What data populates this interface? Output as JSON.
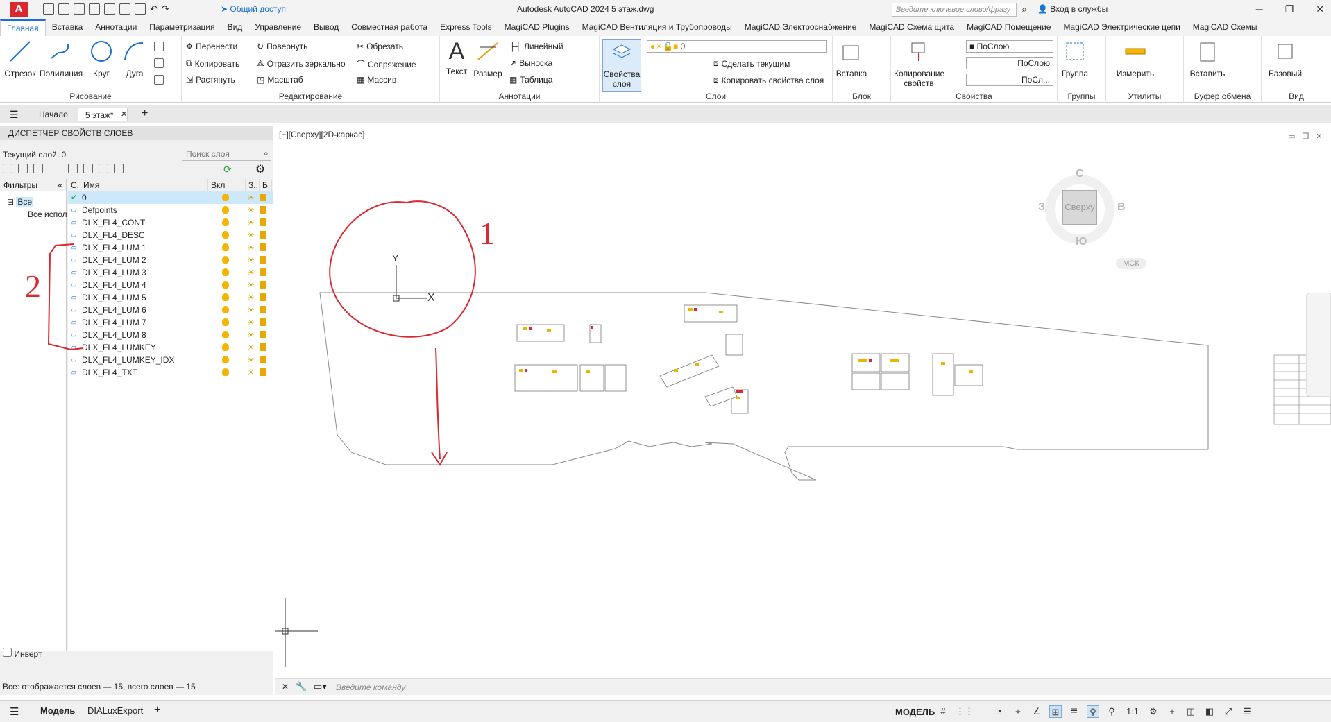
{
  "app": {
    "logo": "A",
    "share": "Общий доступ",
    "title": "Autodesk AutoCAD 2024    5 этаж.dwg",
    "search_placeholder": "Введите ключевое слово/фразу",
    "signin": "Вход в службы"
  },
  "ribbon_tabs": [
    "Главная",
    "Вставка",
    "Аннотации",
    "Параметризация",
    "Вид",
    "Управление",
    "Вывод",
    "Совместная работа",
    "Express Tools",
    "MagiCAD Plugins",
    "MagiCAD Вентиляция и Трубопроводы",
    "MagiCAD Электроснабжение",
    "MagiCAD Схема щита",
    "MagiCAD Помещение",
    "MagiCAD Электрические цепи",
    "MagiCAD Схемы"
  ],
  "ribbon": {
    "draw": {
      "title": "Рисование",
      "line": "Отрезок",
      "polyline": "Полилиния",
      "circle": "Круг",
      "arc": "Дуга"
    },
    "modify": {
      "title": "Редактирование",
      "move": "Перенести",
      "rotate": "Повернуть",
      "trim": "Обрезать",
      "copy": "Копировать",
      "mirror": "Отразить зеркально",
      "fillet": "Сопряжение",
      "stretch": "Растянуть",
      "scale": "Масштаб",
      "array": "Массив"
    },
    "annot": {
      "title": "Аннотации",
      "text": "Текст",
      "dim": "Размер",
      "linear": "Линейный",
      "leader": "Выноска",
      "table": "Таблица"
    },
    "layers": {
      "title": "Слои",
      "props": "Свойства слоя",
      "current_layer": "0",
      "make_current": "Сделать текущим",
      "match": "Копировать свойства слоя"
    },
    "block": {
      "title": "Блок",
      "insert": "Вставка"
    },
    "props": {
      "title": "Свойства",
      "match": "Копирование свойств",
      "color": "ПоСлою",
      "linetype": "ПоСлою",
      "lineweight": "ПоСл..."
    },
    "groups": {
      "title": "Группы",
      "group": "Группа"
    },
    "utils": {
      "title": "Утилиты",
      "measure": "Измерить"
    },
    "clip": {
      "title": "Буфер обмена",
      "paste": "Вставить"
    },
    "view": {
      "title": "Вид",
      "base": "Базовый"
    }
  },
  "doc_tabs": [
    "Начало",
    "5 этаж*"
  ],
  "palette": {
    "title": "ДИСПЕТЧЕР СВОЙСТВ СЛОЕВ",
    "current": "Текущий слой: 0",
    "search": "Поиск слоя",
    "filters": "Фильтры",
    "tree_all": "Все",
    "tree_used": "Все используемые слои",
    "headers": {
      "status": "С.",
      "name": "Имя",
      "on": "Вкл",
      "freeze": "З..",
      "lock": "Б."
    },
    "layers": [
      "0",
      "Defpoints",
      "DLX_FL4_CONT",
      "DLX_FL4_DESC",
      "DLX_FL4_LUM 1",
      "DLX_FL4_LUM 2",
      "DLX_FL4_LUM 3",
      "DLX_FL4_LUM 4",
      "DLX_FL4_LUM 5",
      "DLX_FL4_LUM 6",
      "DLX_FL4_LUM 7",
      "DLX_FL4_LUM 8",
      "DLX_FL4_LUMKEY",
      "DLX_FL4_LUMKEY_IDX",
      "DLX_FL4_TXT"
    ],
    "invert": "Инверт",
    "status": "Все: отображается слоев — 15, всего слоев — 15"
  },
  "viewport": {
    "label": "[−][Сверху][2D-каркас]",
    "viewcube": {
      "top": "Сверху",
      "n": "С",
      "s": "Ю",
      "w": "З",
      "e": "В",
      "wcs": "МСК"
    },
    "annot1": "1",
    "annot2": "2",
    "ucs_x": "X",
    "ucs_y": "Y"
  },
  "command_placeholder": "Введите команду",
  "status_tabs": [
    "Модель",
    "DIALuxExport"
  ],
  "status_model": "МОДЕЛЬ",
  "status_scale": "1:1"
}
